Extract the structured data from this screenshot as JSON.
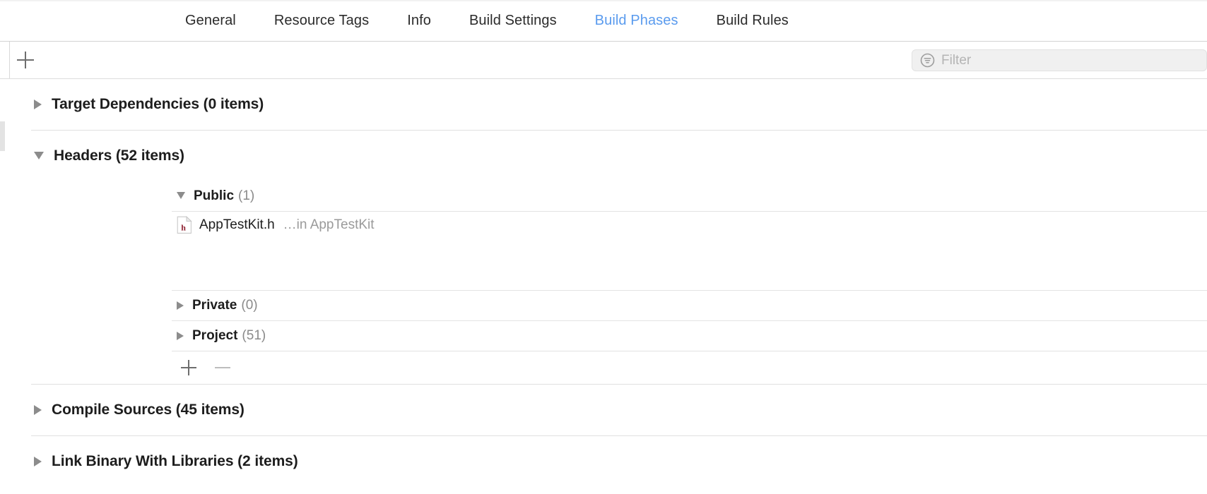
{
  "tabs": [
    {
      "label": "General",
      "active": false
    },
    {
      "label": "Resource Tags",
      "active": false
    },
    {
      "label": "Info",
      "active": false
    },
    {
      "label": "Build Settings",
      "active": false
    },
    {
      "label": "Build Phases",
      "active": true
    },
    {
      "label": "Build Rules",
      "active": false
    }
  ],
  "toolbar": {
    "add_phase_icon": "plus-icon",
    "filter_icon": "filter-circle-icon",
    "filter_placeholder": "Filter",
    "filter_value": ""
  },
  "colors": {
    "active_tab": "#5a9bee",
    "tab_text": "#2b2b2b",
    "title_text": "#1d1d1d",
    "muted_text": "#8a8a8a",
    "placeholder": "#b4b4b4",
    "separator": "#e0e0e0",
    "triangle": "#8c8c8c",
    "header_file_icon": "#8e1f2f"
  },
  "phases": [
    {
      "title": "Target Dependencies (0 items)",
      "name": "Target Dependencies",
      "count": "0 items",
      "expanded": false
    },
    {
      "title": "Headers (52 items)",
      "name": "Headers",
      "count": "52 items",
      "expanded": true,
      "subsections": [
        {
          "name": "Public",
          "count": "(1)",
          "expanded": true,
          "files": [
            {
              "icon": "header-file-icon",
              "icon_letter": "h",
              "name": "AppTestKit.h",
              "location": "…in AppTestKit"
            }
          ]
        },
        {
          "name": "Private",
          "count": "(0)",
          "expanded": false,
          "files": []
        },
        {
          "name": "Project",
          "count": "(51)",
          "expanded": false,
          "files": []
        }
      ],
      "add_button_icon": "plus-icon",
      "remove_button_icon": "minus-icon"
    },
    {
      "title": "Compile Sources (45 items)",
      "name": "Compile Sources",
      "count": "45 items",
      "expanded": false
    },
    {
      "title": "Link Binary With Libraries (2 items)",
      "name": "Link Binary With Libraries",
      "count": "2 items",
      "expanded": false
    }
  ]
}
